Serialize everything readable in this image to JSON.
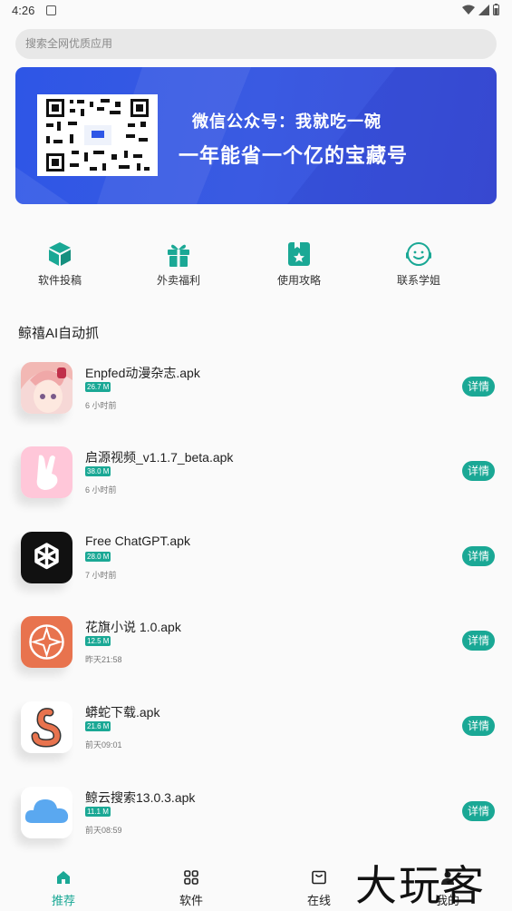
{
  "status_bar": {
    "time": "4:26"
  },
  "search": {
    "placeholder": "搜索全网优质应用"
  },
  "banner": {
    "line1": "微信公众号：我就吃一碗",
    "line2": "一年能省一个亿的宝藏号"
  },
  "quick_links": [
    {
      "label": "软件投稿",
      "icon": "cube-icon"
    },
    {
      "label": "外卖福利",
      "icon": "gift-icon"
    },
    {
      "label": "使用攻略",
      "icon": "bookmark-star-icon"
    },
    {
      "label": "联系学姐",
      "icon": "support-headset-icon"
    }
  ],
  "section_title": "鲸禧AI自动抓",
  "detail_label": "详情",
  "apps": [
    {
      "name": "Enpfed动漫杂志.apk",
      "size": "26.7 M",
      "time": "6 小时前"
    },
    {
      "name": "启源视频_v1.1.7_beta.apk",
      "size": "38.0 M",
      "time": "6 小时前"
    },
    {
      "name": "Free ChatGPT.apk",
      "size": "28.0 M",
      "time": "7 小时前"
    },
    {
      "name": "花旗小说 1.0.apk",
      "size": "12.5 M",
      "time": "昨天21:58"
    },
    {
      "name": "蟒蛇下载.apk",
      "size": "21.6 M",
      "time": "前天09:01"
    },
    {
      "name": "鲸云搜索13.0.3.apk",
      "size": "11.1 M",
      "time": "前天08:59"
    }
  ],
  "tabs": [
    {
      "label": "推荐",
      "icon": "home-icon",
      "active": true
    },
    {
      "label": "软件",
      "icon": "grid-icon",
      "active": false
    },
    {
      "label": "在线",
      "icon": "inbox-icon",
      "active": false
    },
    {
      "label": "我的",
      "icon": "person-icon",
      "active": false
    }
  ],
  "watermark": "大玩客",
  "colors": {
    "accent": "#1aa895",
    "banner": "#3a5ae2"
  }
}
